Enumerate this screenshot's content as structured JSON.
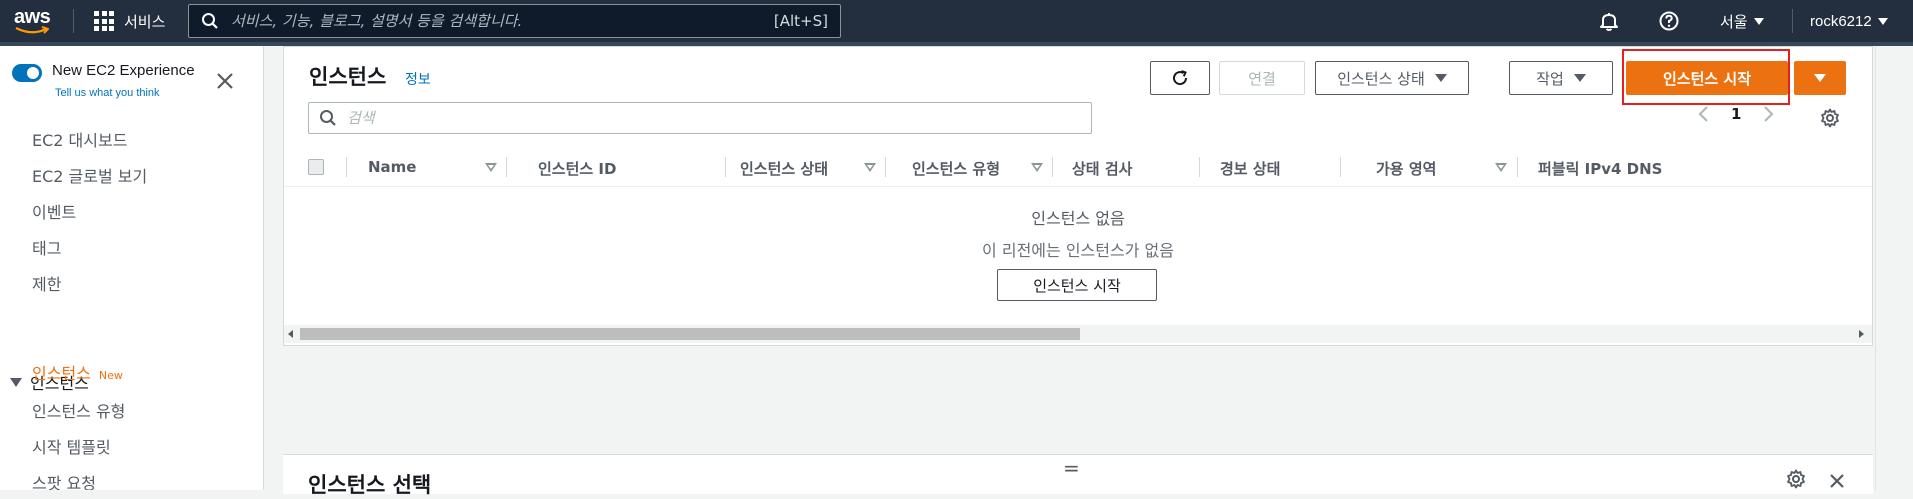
{
  "topnav": {
    "logo_text": "aws",
    "services_label": "서비스",
    "search_placeholder": "서비스, 기능, 블로그, 설명서 등을 검색합니다.",
    "search_shortcut": "[Alt+S]",
    "region_label": "서울",
    "account_label": "rock6212",
    "icons": [
      "grid-icon",
      "search-icon",
      "bell-icon",
      "help-icon"
    ]
  },
  "sidebar": {
    "experience_title": "New EC2 Experience",
    "experience_sub": "Tell us what you think",
    "toggle_on": true,
    "items": [
      "EC2 대시보드",
      "EC2 글로벌 보기",
      "이벤트",
      "태그",
      "제한"
    ],
    "section_label": "인스턴스",
    "section_items": [
      {
        "label": "인스턴스",
        "badge": "New",
        "active": true
      },
      {
        "label": "인스턴스 유형"
      },
      {
        "label": "시작 템플릿"
      },
      {
        "label": "스팟 요청"
      }
    ]
  },
  "main": {
    "title": "인스턴스",
    "info_link": "정보",
    "buttons": {
      "connect": "연결",
      "instance_state": "인스턴스 상태",
      "actions": "작업",
      "launch": "인스턴스 시작"
    },
    "search_placeholder": "검색",
    "page_number": "1",
    "columns": [
      "Name",
      "인스턴스 ID",
      "인스턴스 상태",
      "인스턴스 유형",
      "상태 검사",
      "경보 상태",
      "가용 영역",
      "퍼블릭 IPv4 DNS"
    ],
    "empty_title": "인스턴스 없음",
    "empty_sub": "이 리전에는 인스턴스가 없음",
    "empty_button": "인스턴스 시작",
    "detail_title": "인스턴스 선택",
    "divider_glyph": "="
  },
  "colors": {
    "nav_bg": "#232f3e",
    "primary": "#ec7211",
    "link": "#0073bb",
    "highlight": "#e61f1f"
  }
}
